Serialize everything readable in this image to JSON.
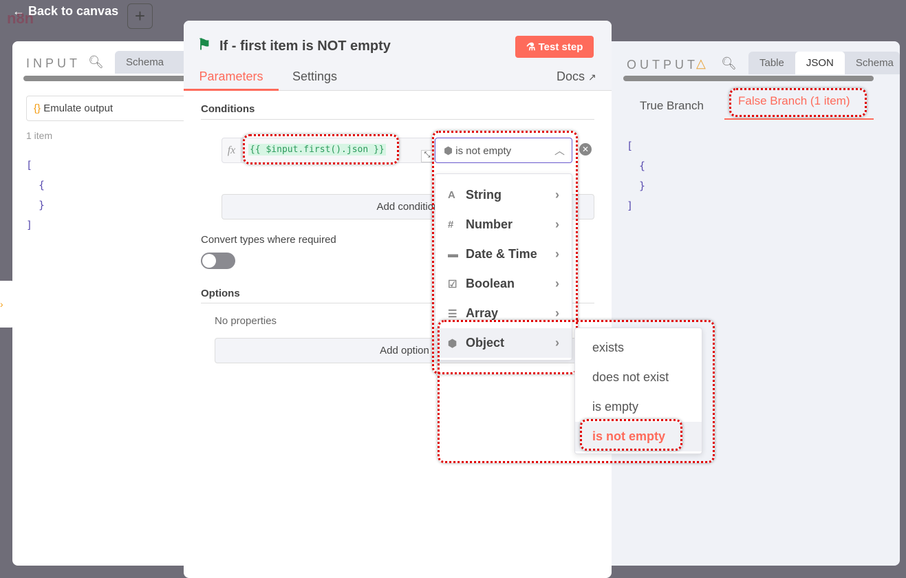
{
  "app": {
    "logo": "n8n",
    "back": "Back to canvas",
    "plus": "+"
  },
  "input": {
    "title": "INPUT",
    "tab": "Schema",
    "emulate": "Emulate output",
    "count": "1 item",
    "json": [
      "[",
      "{",
      "}",
      "]"
    ]
  },
  "modal": {
    "title": "If - first item is NOT empty",
    "test": "Test step",
    "tabs": [
      "Parameters",
      "Settings"
    ],
    "docs": "Docs",
    "conditions": "Conditions",
    "fx": "fx",
    "expression": "{{ $input.first().json }}",
    "operator": "is not empty",
    "add_condition": "Add condition",
    "convert": "Convert types where required",
    "options": "Options",
    "no_props": "No properties",
    "add_option": "Add option"
  },
  "type_menu": [
    {
      "icon": "A",
      "label": "String"
    },
    {
      "icon": "#",
      "label": "Number"
    },
    {
      "icon": "▬",
      "label": "Date & Time"
    },
    {
      "icon": "☑",
      "label": "Boolean"
    },
    {
      "icon": "☰",
      "label": "Array"
    },
    {
      "icon": "⬢",
      "label": "Object"
    }
  ],
  "object_menu": [
    "exists",
    "does not exist",
    "is empty",
    "is not empty"
  ],
  "output": {
    "title": "OUTPUT",
    "tabs": [
      "Table",
      "JSON",
      "Schema"
    ],
    "branches": [
      "True Branch",
      "False Branch (1 item)"
    ],
    "json": [
      "[",
      "{",
      "}",
      "]"
    ]
  }
}
